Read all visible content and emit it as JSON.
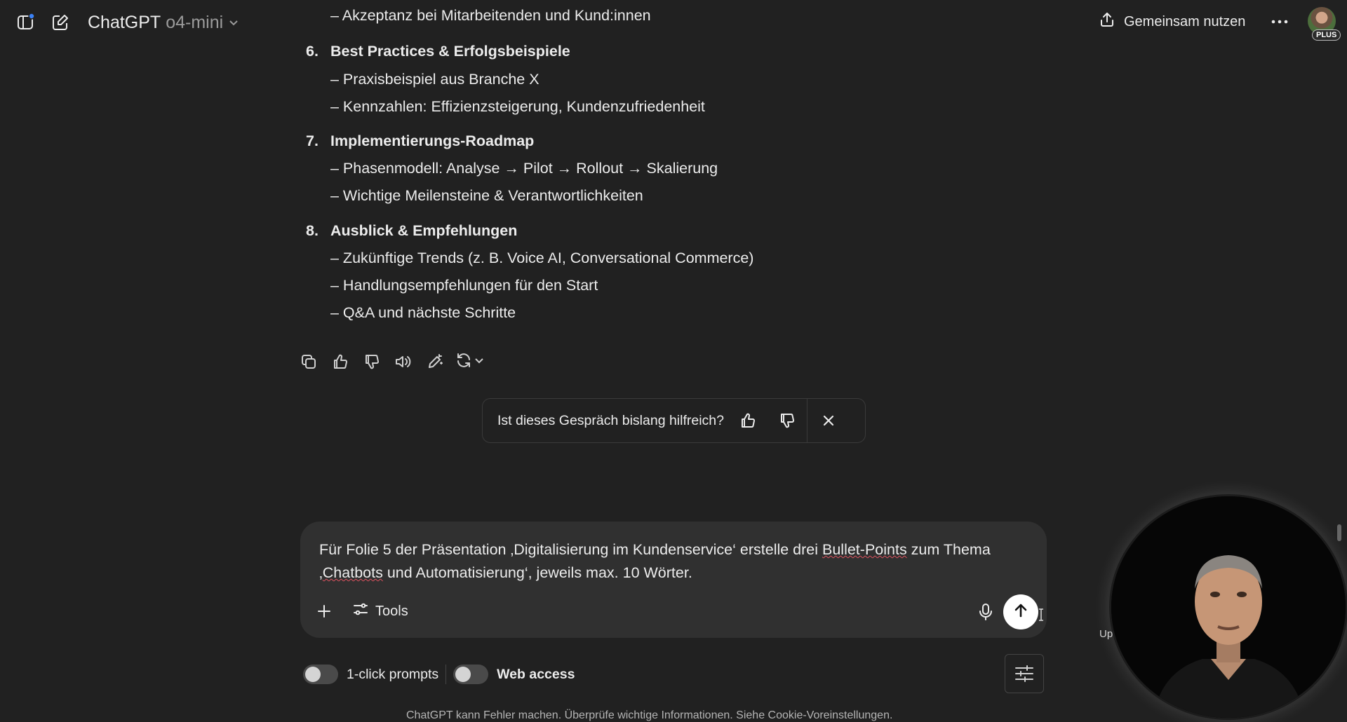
{
  "topbar": {
    "model_name": "ChatGPT",
    "model_variant": "o4-mini",
    "share_label": "Gemeinsam nutzen",
    "plan_badge": "PLUS",
    "icons": [
      "sidebar-toggle-icon",
      "new-chat-icon",
      "chevron-down-icon",
      "share-icon",
      "more-icon"
    ]
  },
  "message": {
    "top_line": "– Akzeptanz bei Mitarbeitenden und Kund:innen",
    "sections": [
      {
        "number": "6.",
        "title": "Best Practices & Erfolgsbeispiele",
        "bullets": [
          "– Praxisbeispiel aus Branche X",
          "– Kennzahlen: Effizienzsteigerung, Kundenzufriedenheit"
        ]
      },
      {
        "number": "7.",
        "title": "Implementierungs-Roadmap",
        "bullets": [
          "– Phasenmodell: Analyse → Pilot → Rollout → Skalierung",
          "– Wichtige Meilensteine & Verantwortlichkeiten"
        ]
      },
      {
        "number": "8.",
        "title": "Ausblick & Empfehlungen",
        "bullets": [
          "– Zukünftige Trends (z. B. Voice AI, Conversational Commerce)",
          "– Handlungsempfehlungen für den Start",
          "– Q&A und nächste Schritte"
        ]
      }
    ]
  },
  "actions": {
    "icons": [
      "copy-icon",
      "thumbs-up-icon",
      "thumbs-down-icon",
      "read-aloud-icon",
      "edit-icon",
      "regenerate-icon"
    ]
  },
  "feedback": {
    "question": "Ist dieses Gespräch bislang hilfreich?"
  },
  "composer": {
    "text_before": "Für Folie 5 der Präsentation ‚Digitalisierung im Kundenservice‘ erstelle drei ",
    "text_spell_1": "Bullet-Points",
    "text_mid": " zum Thema ‚",
    "text_spell_2": "Chatbots",
    "text_after": " und Automatisierung‘, jeweils max. 10 Wörter.",
    "tools_label": "Tools"
  },
  "toggles": {
    "one_click_label": "1-click prompts",
    "one_click_on": false,
    "web_access_label": "Web access",
    "web_access_on": false
  },
  "footer": {
    "text": "ChatGPT kann Fehler machen. Überprüfe wichtige Informationen. Siehe Cookie-Voreinstellungen."
  },
  "background_label": "UpN",
  "colors": {
    "background": "#212121",
    "composer": "#303030",
    "text": "#ececec",
    "muted": "#9b9b9b",
    "notification_dot": "#3b82f6"
  }
}
